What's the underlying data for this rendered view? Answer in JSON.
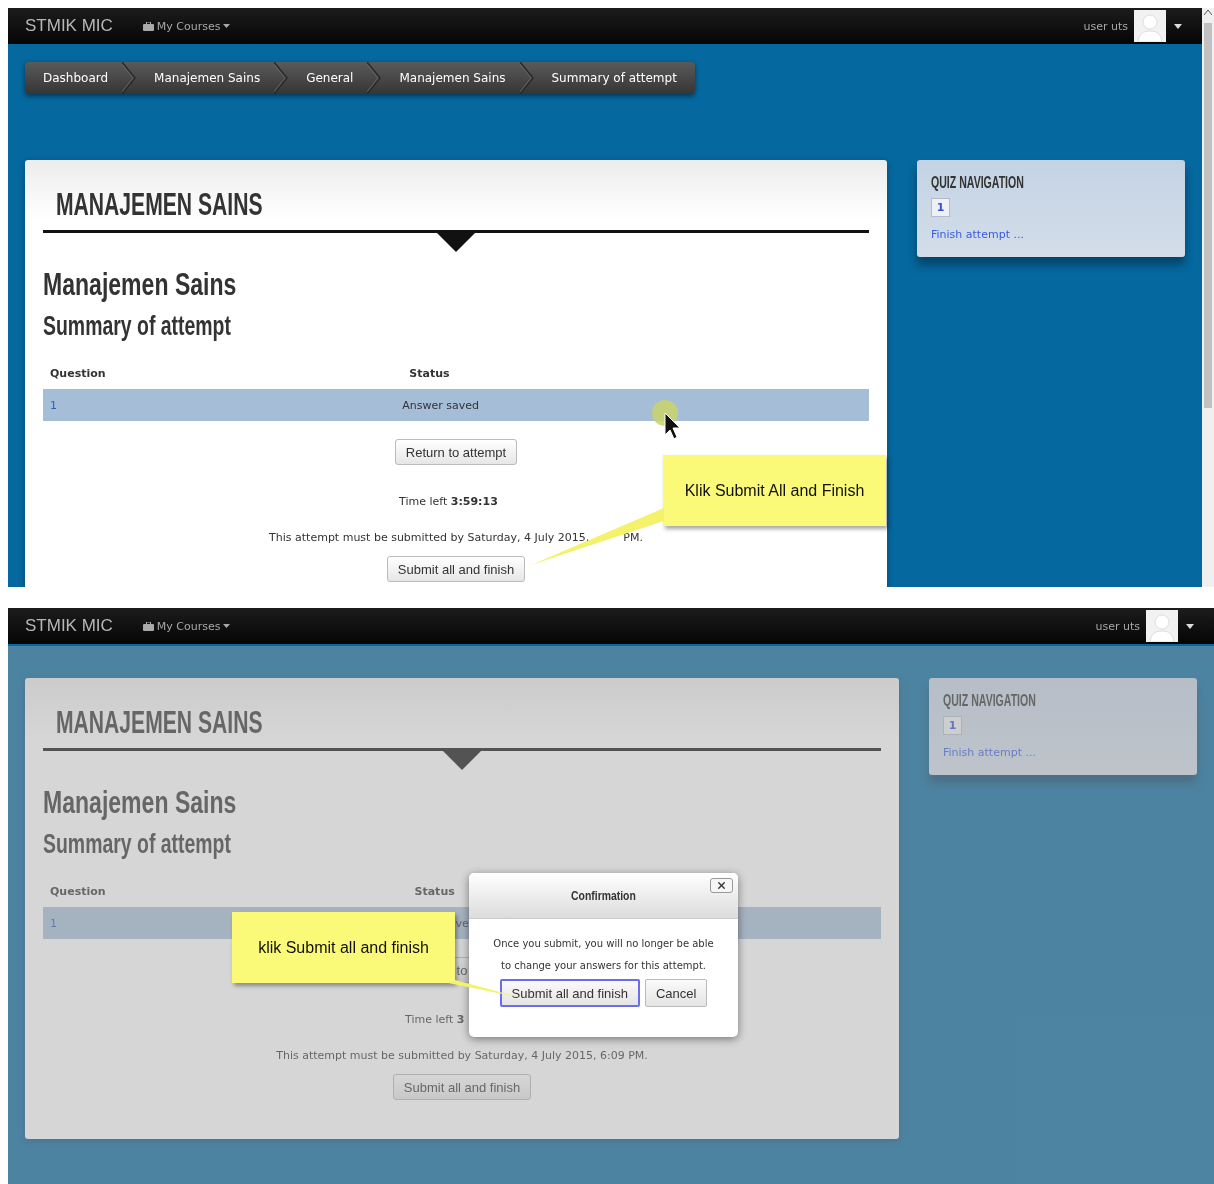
{
  "screens": [
    {
      "navbar": {
        "brand": "STMIK MIC",
        "menu": "My Courses",
        "user": "user uts"
      },
      "breadcrumb": [
        "Dashboard",
        "Manajemen Sains",
        "General",
        "Manajemen Sains",
        "Summary of attempt"
      ],
      "page_title": "MANAJEMEN SAINS",
      "course": "Manajemen Sains",
      "heading": "Summary of attempt",
      "table": {
        "columns": [
          "Question",
          "Status"
        ],
        "rows": [
          {
            "question": "1",
            "status": "Answer saved",
            "highlighted": true
          }
        ]
      },
      "return_button": "Return to attempt",
      "time_left": "Time left **3:59:13**",
      "deadline": [
        "This attempt must be submitted by Saturday, 4 July 2015,",
        "PM."
      ],
      "submit_button": "Submit all and finish",
      "quiz_navigation": {
        "title": "QUIZ NAVIGATION",
        "questions": [
          "1"
        ],
        "finish_link": "Finish attempt ..."
      },
      "callout": {
        "text": "Klik Submit All and Finish"
      },
      "cursor_highlight": true,
      "scrollbar": true
    },
    {
      "navbar": {
        "brand": "STMIK MIC",
        "menu": "My Courses",
        "user": "user uts"
      },
      "page_title": "MANAJEMEN SAINS",
      "course": "Manajemen Sains",
      "heading": "Summary of attempt",
      "table": {
        "columns": [
          "Question",
          "Status"
        ],
        "rows": [
          {
            "question": "1",
            "status": "ve",
            "highlighted": true
          }
        ]
      },
      "return_button": "to",
      "time_left": "Time left **3**",
      "deadline": [
        "This attempt must be submitted by Saturday, 4 July 2015, 6:09 PM."
      ],
      "submit_button": "Submit all and finish",
      "quiz_navigation": {
        "title": "QUIZ NAVIGATION",
        "questions": [
          "1"
        ],
        "finish_link": "Finish attempt ..."
      },
      "dialog": {
        "title": "Confirmation",
        "message": "Once you submit, you will no longer be able to change your answers for this attempt.",
        "confirm": "Submit all and finish",
        "cancel": "Cancel"
      },
      "callout": {
        "text": "klik Submit all and finish"
      },
      "cursor_highlight": false,
      "scrollbar": false
    }
  ]
}
